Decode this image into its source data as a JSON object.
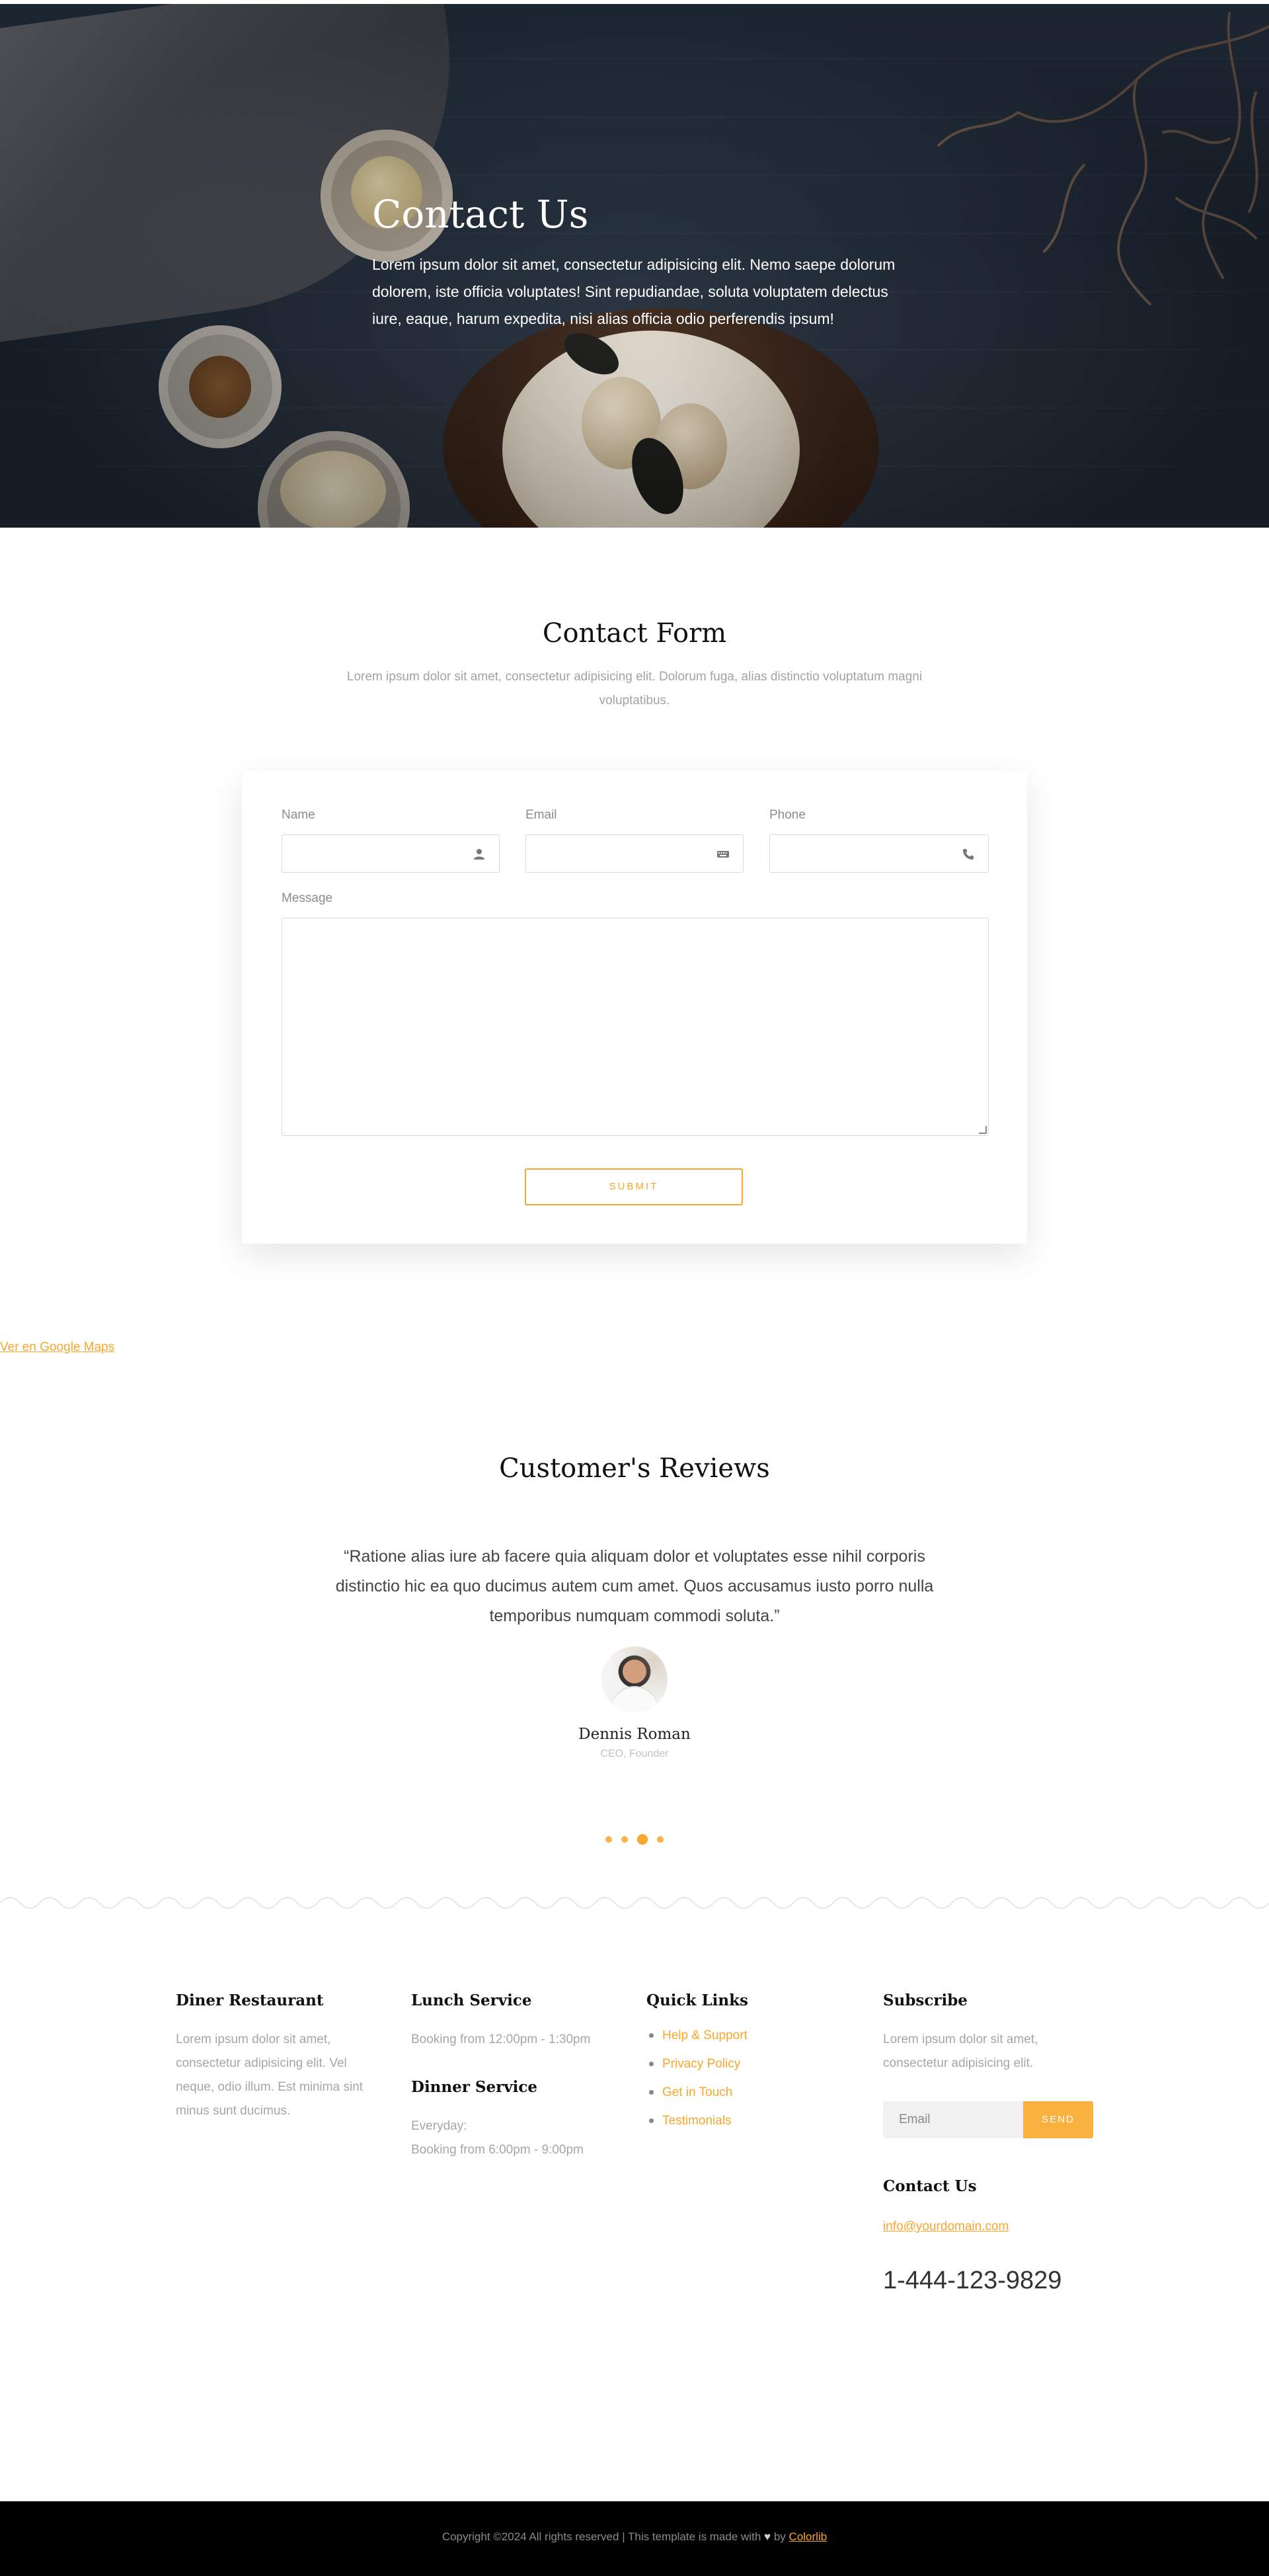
{
  "hero": {
    "title": "Contact Us",
    "text": "Lorem ipsum dolor sit amet, consectetur adipisicing elit. Nemo saepe dolorum dolorem, iste officia voluptates! Sint repudiandae, soluta voluptatem delectus iure, eaque, harum expedita, nisi alias officia odio perferendis ipsum!"
  },
  "contact_form": {
    "title": "Contact Form",
    "subtitle": "Lorem ipsum dolor sit amet, consectetur adipisicing elit. Dolorum fuga, alias distinctio voluptatum magni voluptatibus.",
    "fields": {
      "name_label": "Name",
      "email_label": "Email",
      "phone_label": "Phone",
      "message_label": "Message",
      "name_value": "",
      "email_value": "",
      "phone_value": "",
      "message_value": ""
    },
    "submit_label": "SUBMIT"
  },
  "maps_link": "Ver en Google Maps",
  "reviews": {
    "title": "Customer's Reviews",
    "quote": "“Ratione alias iure ab facere quia aliquam dolor et voluptates esse nihil corporis distinctio hic ea quo ducimus autem cum amet. Quos accusamus iusto porro nulla temporibus numquam commodi soluta.”",
    "reviewer_name": "Dennis Roman",
    "reviewer_role": "CEO, Founder",
    "dots_count": 4,
    "active_dot": 3
  },
  "footer": {
    "about": {
      "heading": "Diner Restaurant",
      "text": "Lorem ipsum dolor sit amet, consectetur adipisicing elit. Vel neque, odio illum. Est minima sint minus sunt ducimus."
    },
    "lunch": {
      "heading": "Lunch Service",
      "text": "Booking from 12:00pm - 1:30pm"
    },
    "dinner": {
      "heading": "Dinner Service",
      "line1": "Everyday:",
      "line2": "Booking from 6:00pm - 9:00pm"
    },
    "quick_links": {
      "heading": "Quick Links",
      "items": [
        "Help & Support",
        "Privacy Policy",
        "Get in Touch",
        "Testimonials"
      ]
    },
    "subscribe": {
      "heading": "Subscribe",
      "text": "Lorem ipsum dolor sit amet, consectetur adipisicing elit.",
      "email_placeholder": "Email",
      "send_label": "SEND"
    },
    "contact": {
      "heading": "Contact Us",
      "email": "info@yourdomain.com",
      "phone": "1-444-123-9829"
    }
  },
  "copyright": {
    "text": "Copyright ©2024 All rights reserved | This template is made with",
    "by": "by",
    "brand": "Colorlib"
  },
  "colors": {
    "accent": "#f9a62b",
    "footer_bar": "#000000",
    "hero_overlay": "#1f2b3a"
  }
}
